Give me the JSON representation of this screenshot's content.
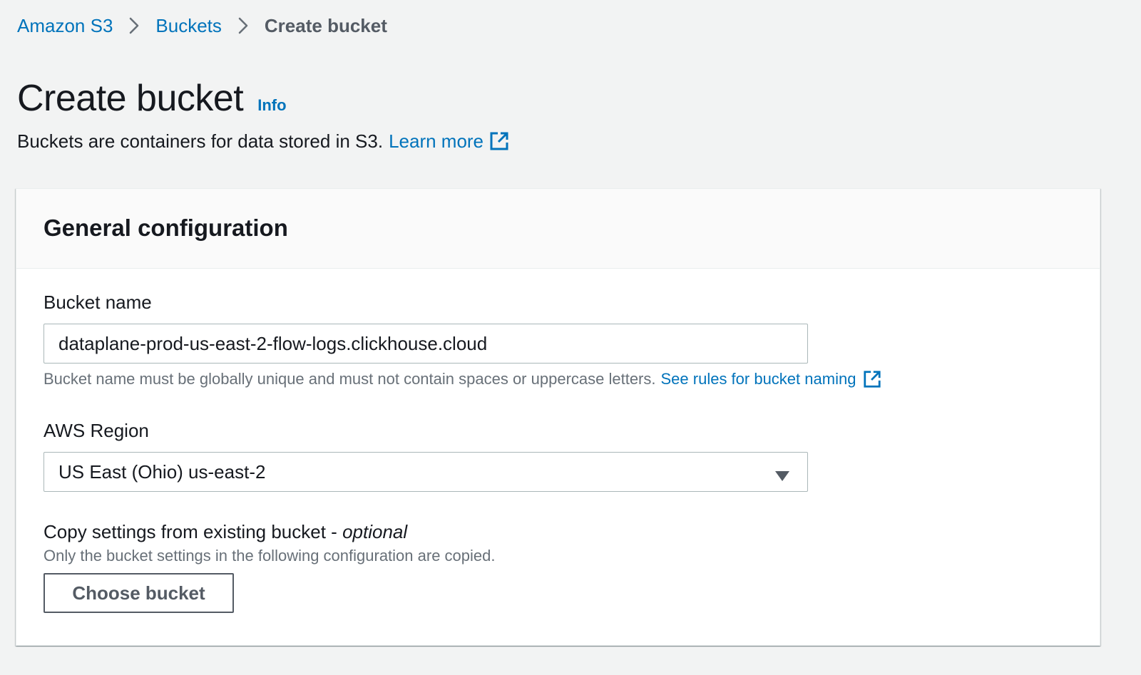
{
  "breadcrumb": {
    "items": [
      {
        "label": "Amazon S3"
      },
      {
        "label": "Buckets"
      },
      {
        "label": "Create bucket"
      }
    ]
  },
  "header": {
    "title": "Create bucket",
    "info_label": "Info",
    "subtitle": "Buckets are containers for data stored in S3.",
    "learn_more": "Learn more"
  },
  "general_configuration": {
    "title": "General configuration",
    "bucket_name": {
      "label": "Bucket name",
      "value": "dataplane-prod-us-east-2-flow-logs.clickhouse.cloud",
      "hint": "Bucket name must be globally unique and must not contain spaces or uppercase letters.",
      "rules_link": "See rules for bucket naming"
    },
    "region": {
      "label": "AWS Region",
      "selected": "US East (Ohio) us-east-2"
    },
    "copy_settings": {
      "label": "Copy settings from existing bucket - ",
      "optional": "optional",
      "hint": "Only the bucket settings in the following configuration are copied.",
      "button": "Choose bucket"
    }
  },
  "colors": {
    "link": "#0073bb",
    "text": "#16191f",
    "secondary_text": "#687078",
    "background": "#f2f3f3"
  }
}
